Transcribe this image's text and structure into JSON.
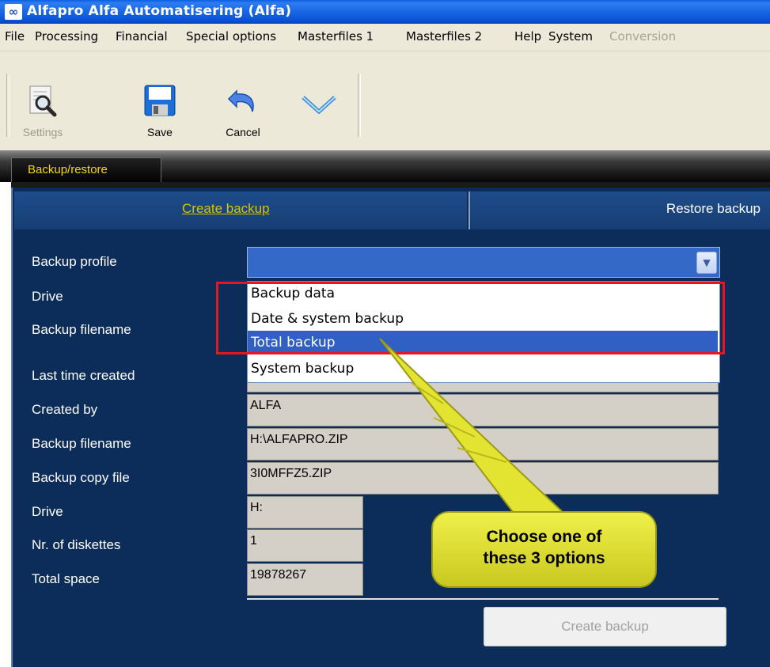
{
  "window": {
    "title": "Alfapro Alfa Automatisering (Alfa)",
    "icon_glyph": "∞"
  },
  "menu": {
    "items": [
      "File",
      "Processing",
      "Financial",
      "Special options",
      "Masterfiles 1",
      "Masterfiles 2",
      "Help",
      "System"
    ],
    "disabled_item": "Conversion"
  },
  "toolbar": {
    "settings_label": "Settings",
    "save_label": "Save",
    "cancel_label": "Cancel"
  },
  "tabs": {
    "outer": "Backup/restore",
    "create": "Create backup",
    "restore": "Restore backup"
  },
  "form": {
    "labels": {
      "backup_profile": "Backup profile",
      "drive": "Drive",
      "backup_filename": "Backup filename",
      "last_time_created": "Last time created",
      "created_by": "Created by",
      "backup_filename2": "Backup filename",
      "backup_copy_file": "Backup copy file",
      "drive2": "Drive",
      "nr_diskettes": "Nr. of diskettes",
      "total_space": "Total space"
    },
    "dropdown_options": [
      "Backup data",
      "Date & system backup",
      "Total backup",
      "System backup"
    ],
    "selected_option": "Total backup",
    "values": {
      "created_by": "ALFA",
      "backup_filename": "H:\\ALFAPRO.ZIP",
      "backup_copy_file": "3I0MFFZ5.ZIP",
      "drive": "H:",
      "nr_diskettes": "1",
      "total_space": "19878267"
    },
    "create_button": "Create backup"
  },
  "callout": {
    "line1": "Choose one of",
    "line2": "these 3 options"
  },
  "colors": {
    "titlebar": "#0a5ee0",
    "panel": "#0c2c5a",
    "selection": "#3160c4",
    "highlight": "#e8141e",
    "callout": "#e6e635",
    "active_tab_text": "#d9c400"
  }
}
